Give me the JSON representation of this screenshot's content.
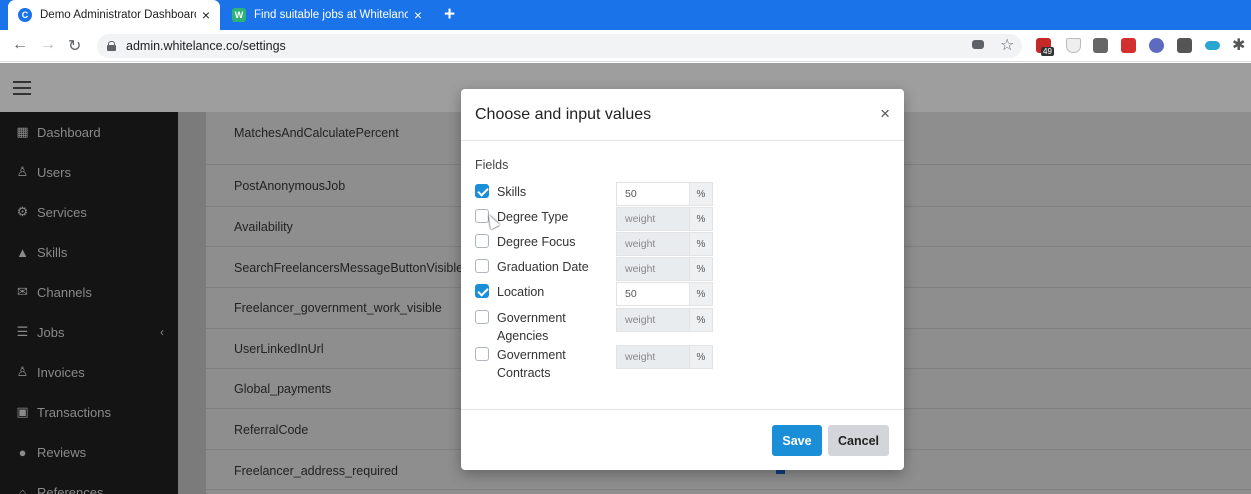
{
  "browser": {
    "tabs": [
      {
        "title": "Demo Administrator Dashboard",
        "close": "×",
        "active": true
      },
      {
        "title": "Find suitable jobs at Whitelance.",
        "close": "×",
        "active": false
      }
    ],
    "new_tab": "+",
    "url": "admin.whitelance.co/settings",
    "badge": "49"
  },
  "sidebar": {
    "items": [
      {
        "label": "Dashboard",
        "icon": "dashboard-icon"
      },
      {
        "label": "Users",
        "icon": "user-icon"
      },
      {
        "label": "Services",
        "icon": "gear-icon"
      },
      {
        "label": "Skills",
        "icon": "graduation-cap-icon"
      },
      {
        "label": "Channels",
        "icon": "envelope-icon"
      },
      {
        "label": "Jobs",
        "icon": "list-icon",
        "chevron": "‹"
      },
      {
        "label": "Invoices",
        "icon": "user-plus-icon"
      },
      {
        "label": "Transactions",
        "icon": "money-icon"
      },
      {
        "label": "Reviews",
        "icon": "comments-icon"
      },
      {
        "label": "References",
        "icon": "bank-icon"
      }
    ]
  },
  "settings": {
    "rows": [
      "MatchesAndCalculatePercent",
      "PostAnonymousJob",
      "Availability",
      "SearchFreelancersMessageButtonVisible",
      "Freelancer_government_work_visible",
      "UserLinkedInUrl",
      "Global_payments",
      "ReferralCode",
      "Freelancer_address_required"
    ]
  },
  "modal": {
    "title": "Choose and input values",
    "close": "×",
    "fields_label": "Fields",
    "fields": [
      {
        "label": "Skills",
        "checked": true,
        "value": "50",
        "placeholder": "weight",
        "suffix": "%"
      },
      {
        "label": "Degree Type",
        "checked": false,
        "value": "",
        "placeholder": "weight",
        "suffix": "%"
      },
      {
        "label": "Degree Focus",
        "checked": false,
        "value": "",
        "placeholder": "weight",
        "suffix": "%"
      },
      {
        "label": "Graduation Date",
        "checked": false,
        "value": "",
        "placeholder": "weight",
        "suffix": "%"
      },
      {
        "label": "Location",
        "checked": true,
        "value": "50",
        "placeholder": "weight",
        "suffix": "%"
      },
      {
        "label": "Government Agencies",
        "checked": false,
        "value": "",
        "placeholder": "weight",
        "suffix": "%"
      },
      {
        "label": "Government Contracts",
        "checked": false,
        "value": "",
        "placeholder": "weight",
        "suffix": "%"
      }
    ],
    "save_label": "Save",
    "cancel_label": "Cancel"
  },
  "colors": {
    "chrome_blue": "#1a73e8",
    "primary": "#1a8fd8",
    "sidebar_bg": "#141414"
  }
}
